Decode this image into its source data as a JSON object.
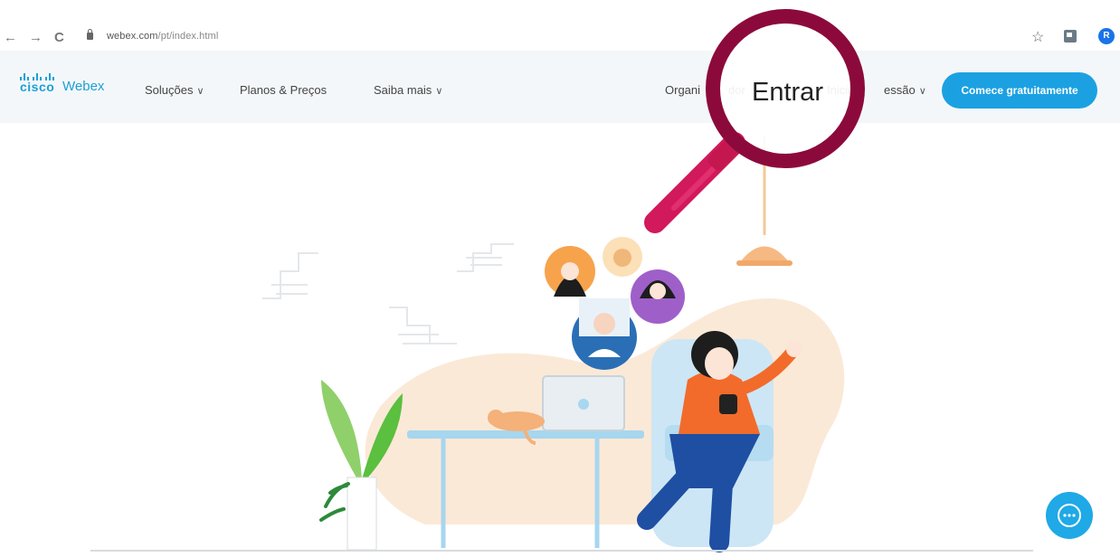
{
  "browser": {
    "nav_back": "←",
    "nav_forward": "→",
    "nav_reload": "C",
    "url_domain": "webex.com",
    "url_path": "/pt/index.html",
    "profile_initial": "R",
    "bookmark_icon": "☆"
  },
  "header": {
    "logo_cisco": "cisco",
    "logo_webex": "Webex",
    "menu": [
      {
        "label": "Soluções",
        "chevron": "∨"
      },
      {
        "label": "Planos & Preços",
        "chevron": ""
      },
      {
        "label": "Saiba mais",
        "chevron": "∨"
      }
    ],
    "organizer_label": "Organizador",
    "organizer_visible_start": "Organi",
    "organizer_visible_end": "dor",
    "signin_label": "Iniciar sessão",
    "signin_visible_start": "Iniciar",
    "signin_visible_end": "essão",
    "signin_chevron": "∨",
    "cta_label": "Comece gratuitamente"
  },
  "annotation": {
    "magnified_label": "Entrar",
    "magnifier_color": "#8c0a3b",
    "handle_color": "#d1195b"
  },
  "colors": {
    "brand_blue": "#1ba1e2",
    "header_bg": "#f4f7f9"
  }
}
